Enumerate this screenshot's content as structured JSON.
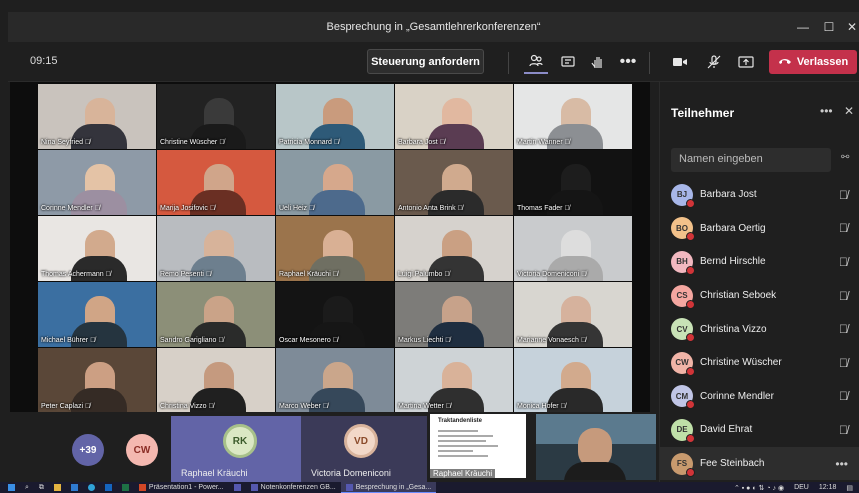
{
  "window": {
    "title": "Besprechung in „Gesamtlehrerkonferenzen“"
  },
  "toolbar": {
    "time": "09:15",
    "request_control_label": "Steuerung anfordern",
    "leave_label": "Verlassen"
  },
  "grid": [
    {
      "name": "Nina Seyfried",
      "bg": "#c9c3bd",
      "skin": "#d8b49a",
      "shirt": "#34343c"
    },
    {
      "name": "Christine Wüscher",
      "bg": "#222222",
      "skin": "#3a3a3a",
      "shirt": "#1a1a1a"
    },
    {
      "name": "Patricia Monnard",
      "bg": "#b8c6c8",
      "skin": "#c99b7d",
      "shirt": "#2e5a78"
    },
    {
      "name": "Barbara Jost",
      "bg": "#d9d2c6",
      "skin": "#e1b8a0",
      "shirt": "#5a3c52"
    },
    {
      "name": "Martin Wanner",
      "bg": "#e5e6e6",
      "skin": "#d8bba5",
      "shirt": "#8c8f93"
    },
    {
      "name": "Corinne Mendler",
      "bg": "#8e9aa7",
      "skin": "#e4c3a6",
      "shirt": "#9c8fa1"
    },
    {
      "name": "Marija Josifovic",
      "bg": "#d5593f",
      "skin": "#d0a58a",
      "shirt": "#6a2f23"
    },
    {
      "name": "Ueli Heiz",
      "bg": "#8a9aa3",
      "skin": "#d6a88c",
      "shirt": "#4d6a8c"
    },
    {
      "name": "Antonio Anta Brink",
      "bg": "#6a5a4d",
      "skin": "#d0aa8e",
      "shirt": "#2b2b2b"
    },
    {
      "name": "Thomas Fader",
      "bg": "#121212",
      "skin": "#1d1d1d",
      "shirt": "#151515"
    },
    {
      "name": "Thomas Achermann",
      "bg": "#e9e6e3",
      "skin": "#d2aa8d",
      "shirt": "#2a2a2a"
    },
    {
      "name": "Remo Pesenti",
      "bg": "#b9bcc0",
      "skin": "#d7b39a",
      "shirt": "#6d7f8e"
    },
    {
      "name": "Raphael Kräuchi",
      "bg": "#9b744c",
      "skin": "#d9b094",
      "shirt": "#6f6f62"
    },
    {
      "name": "Luigi Palumbo",
      "bg": "#d6d2cd",
      "skin": "#caa083",
      "shirt": "#343434"
    },
    {
      "name": "Victoria Domeniconi",
      "bg": "#c9cbcd",
      "skin": "#ddd",
      "shirt": "#aaaaaa"
    },
    {
      "name": "Michael Bührer",
      "bg": "#3b6fa1",
      "skin": "#d0a586",
      "shirt": "#25343f"
    },
    {
      "name": "Sandro Garigliano",
      "bg": "#8c8f78",
      "skin": "#caa388",
      "shirt": "#2a2b2a"
    },
    {
      "name": "Oscar Mesonero",
      "bg": "#141414",
      "skin": "#1b1b1b",
      "shirt": "#161616"
    },
    {
      "name": "Markus Liechti",
      "bg": "#7d7c79",
      "skin": "#c7a28a",
      "shirt": "#1f2e40"
    },
    {
      "name": "Marianne Vonaesch",
      "bg": "#d8d6d0",
      "skin": "#d6b29d",
      "shirt": "#353535"
    },
    {
      "name": "Peter Caplazi",
      "bg": "#5a4738",
      "skin": "#cc9f83",
      "shirt": "#352b25"
    },
    {
      "name": "Christina Vizzo",
      "bg": "#d7d0c8",
      "skin": "#c59a7f",
      "shirt": "#202020"
    },
    {
      "name": "Marco Weber",
      "bg": "#7e8b98",
      "skin": "#caa68b",
      "shirt": "#36485a"
    },
    {
      "name": "Martina Wetter",
      "bg": "#ced3d6",
      "skin": "#d9b299",
      "shirt": "#2f2f2f"
    },
    {
      "name": "Monica Hofer",
      "bg": "#c6d2db",
      "skin": "#d2aa8d",
      "shirt": "#292929"
    }
  ],
  "bottom": {
    "overflow_count": "+39",
    "cw_initials": "CW",
    "tile1": {
      "initials": "RK",
      "label": "Raphael Kräuchi"
    },
    "tile2": {
      "initials": "VD",
      "label": "Victoria Domeniconi"
    },
    "slide": {
      "title": "Traktandenliste",
      "label": "Raphael Kräuchi"
    }
  },
  "panel": {
    "title": "Teilnehmer",
    "search_placeholder": "Namen eingeben",
    "participants": [
      {
        "initials": "BJ",
        "name": "Barbara Jost",
        "color": "#a7b6e8"
      },
      {
        "initials": "BO",
        "name": "Barbara Oertig",
        "color": "#f2c18a"
      },
      {
        "initials": "BH",
        "name": "Bernd Hirschle",
        "color": "#f2b8c0"
      },
      {
        "initials": "CS",
        "name": "Christian Seboek",
        "color": "#f4a6a0"
      },
      {
        "initials": "CV",
        "name": "Christina Vizzo",
        "color": "#c8e2b6"
      },
      {
        "initials": "CW",
        "name": "Christine Wüscher",
        "color": "#f1b4a7"
      },
      {
        "initials": "CM",
        "name": "Corinne Mendler",
        "color": "#c0c5e6"
      },
      {
        "initials": "DE",
        "name": "David Ehrat",
        "color": "#bfe0a8"
      },
      {
        "initials": "FS",
        "name": "Fee Steinbach",
        "color": "#c89a6e"
      }
    ]
  },
  "taskbar": {
    "items": [
      "Präsentation1 - Power...",
      "Notenkonferenzen GB...",
      "Besprechung in „Gesa..."
    ],
    "lang": "DEU",
    "clock": "12:18"
  }
}
